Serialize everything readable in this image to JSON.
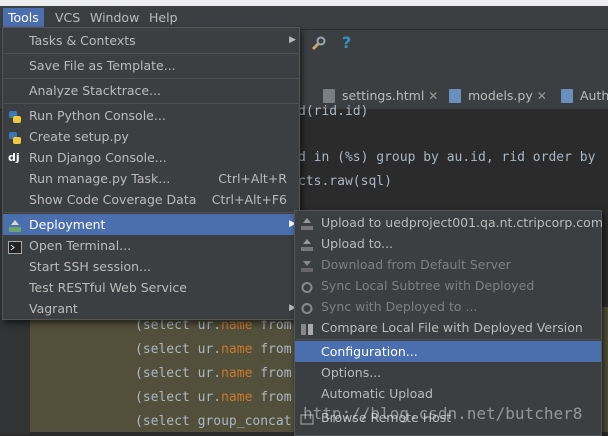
{
  "menubar": {
    "items": [
      "Tools",
      "VCS",
      "Window",
      "Help"
    ]
  },
  "tabs": [
    {
      "label": "settings.html"
    },
    {
      "label": "models.py"
    },
    {
      "label": "AuthV"
    }
  ],
  "editor": {
    "lines": [
      {
        "text_a": "d(rid.id)",
        "y": 0
      },
      {
        "text_a": "d in (%s) group by au.id, rid order by"
      },
      {
        "text_a": "cts.raw(sql)"
      },
      {
        "text_a": "(select ur.",
        "field": "name",
        "text_b": " from"
      },
      {
        "text_a": "(select ur.",
        "field": "name",
        "text_b": " from"
      },
      {
        "text_a": "(select ur.",
        "field": "name",
        "text_b": " from"
      },
      {
        "text_a": "(select ur.",
        "field": "name",
        "text_b": " from"
      },
      {
        "text_a": "(select group_concat"
      }
    ]
  },
  "tools_menu": {
    "items": [
      {
        "label": "Tasks & Contexts",
        "submenu": true
      },
      {
        "label": "Save File as Template..."
      },
      {
        "label": "Analyze Stacktrace..."
      },
      {
        "label": "Run Python Console..."
      },
      {
        "label": "Create setup.py"
      },
      {
        "label": "Run Django Console..."
      },
      {
        "label": "Run manage.py Task...",
        "shortcut": "Ctrl+Alt+R"
      },
      {
        "label": "Show Code Coverage Data",
        "shortcut": "Ctrl+Alt+F6"
      },
      {
        "label": "Deployment",
        "submenu": true
      },
      {
        "label": "Open Terminal..."
      },
      {
        "label": "Start SSH session..."
      },
      {
        "label": "Test RESTful Web Service"
      },
      {
        "label": "Vagrant",
        "submenu": true
      }
    ]
  },
  "deployment_menu": {
    "items": [
      {
        "label": "Upload to uedproject001.qa.nt.ctripcorp.com"
      },
      {
        "label": "Upload to..."
      },
      {
        "label": "Download from Default Server"
      },
      {
        "label": "Sync Local Subtree with Deployed"
      },
      {
        "label": "Sync with Deployed to ..."
      },
      {
        "label": "Compare Local File with Deployed Version"
      },
      {
        "label": "Configuration..."
      },
      {
        "label": "Options..."
      },
      {
        "label": "Automatic Upload"
      },
      {
        "label": "Browse Remote Host"
      }
    ]
  },
  "watermark": "http://blog.csdn.net/butcher8",
  "colors": {
    "selection": "#4b6eaf",
    "menu_bg": "#3c3f41",
    "editor_bg": "#2b2b2b"
  }
}
